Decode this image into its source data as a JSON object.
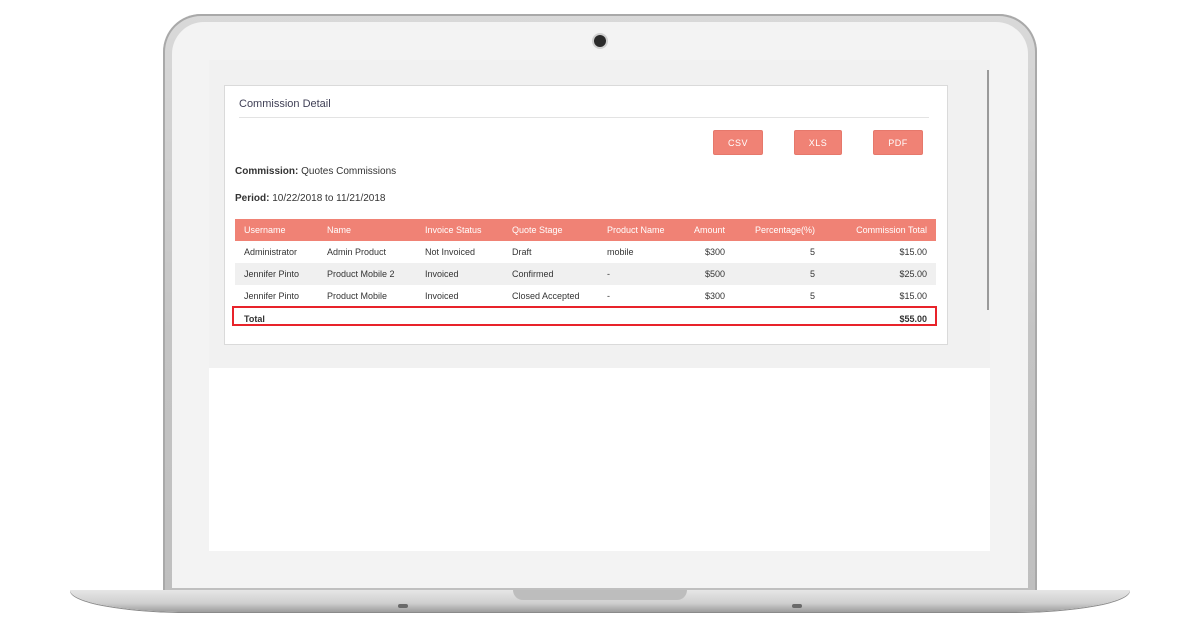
{
  "panel": {
    "title": "Commission Detail"
  },
  "export_buttons": {
    "csv": "CSV",
    "xls": "XLS",
    "pdf": "PDF"
  },
  "commission": {
    "label": "Commission:",
    "value": "Quotes Commissions"
  },
  "period": {
    "label": "Period:",
    "value": "10/22/2018 to 11/21/2018"
  },
  "table": {
    "columns": [
      "Username",
      "Name",
      "Invoice Status",
      "Quote Stage",
      "Product Name",
      "Amount",
      "Percentage(%)",
      "Commission Total"
    ],
    "rows": [
      [
        "Administrator",
        "Admin Product",
        "Not Invoiced",
        "Draft",
        "mobile",
        "$300",
        "5",
        "$15.00"
      ],
      [
        "Jennifer Pinto",
        "Product Mobile 2",
        "Invoiced",
        "Confirmed",
        "-",
        "$500",
        "5",
        "$25.00"
      ],
      [
        "Jennifer Pinto",
        "Product Mobile",
        "Invoiced",
        "Closed Accepted",
        "-",
        "$300",
        "5",
        "$15.00"
      ]
    ],
    "total": {
      "label": "Total",
      "value": "$55.00"
    }
  },
  "colors": {
    "accent": "#f08275",
    "highlight": "#e8232a"
  }
}
